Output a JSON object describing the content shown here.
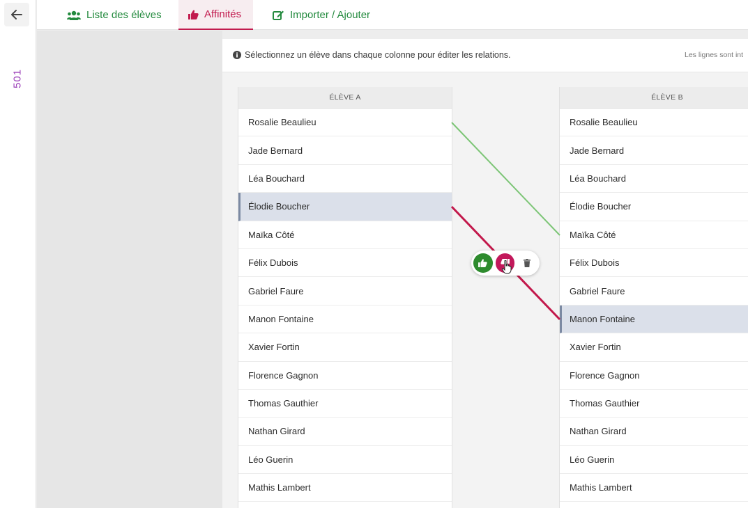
{
  "app": {
    "class_label": "501"
  },
  "tabs": [
    {
      "label": "Liste des élèves",
      "icon": "users-icon"
    },
    {
      "label": "Affinités",
      "icon": "thumbs-up-icon"
    },
    {
      "label": "Importer / Ajouter",
      "icon": "edit-icon"
    }
  ],
  "info": {
    "text": "Sélectionnez un élève dans chaque colonne pour éditer les relations.",
    "right_text": "Les lignes sont int"
  },
  "column_a": {
    "header": "ÉLÈVE A",
    "students": [
      "Rosalie Beaulieu",
      "Jade Bernard",
      "Léa Bouchard",
      "Élodie Boucher",
      "Maïka Côté",
      "Félix Dubois",
      "Gabriel Faure",
      "Manon Fontaine",
      "Xavier Fortin",
      "Florence Gagnon",
      "Thomas Gauthier",
      "Nathan Girard",
      "Léo Guerin",
      "Mathis Lambert"
    ],
    "selected": "Élodie Boucher"
  },
  "column_b": {
    "header": "ÉLÈVE B",
    "students": [
      "Rosalie Beaulieu",
      "Jade Bernard",
      "Léa Bouchard",
      "Élodie Boucher",
      "Maïka Côté",
      "Félix Dubois",
      "Gabriel Faure",
      "Manon Fontaine",
      "Xavier Fortin",
      "Florence Gagnon",
      "Thomas Gauthier",
      "Nathan Girard",
      "Léo Guerin",
      "Mathis Lambert"
    ],
    "selected": "Manon Fontaine"
  },
  "relations": [
    {
      "from": "Rosalie Beaulieu",
      "to": "Maïka Côté",
      "type": "like",
      "color": "#7cc576"
    },
    {
      "from": "Élodie Boucher",
      "to": "Manon Fontaine",
      "type": "dislike",
      "color": "#c2184b"
    }
  ],
  "actions": [
    {
      "name": "like",
      "icon": "thumbs-up-icon"
    },
    {
      "name": "dislike",
      "icon": "thumbs-down-icon"
    },
    {
      "name": "delete",
      "icon": "trash-icon"
    }
  ],
  "colors": {
    "accent": "#c21a4e",
    "tab_green": "#238a3e",
    "class_label": "#9b3fb8"
  }
}
